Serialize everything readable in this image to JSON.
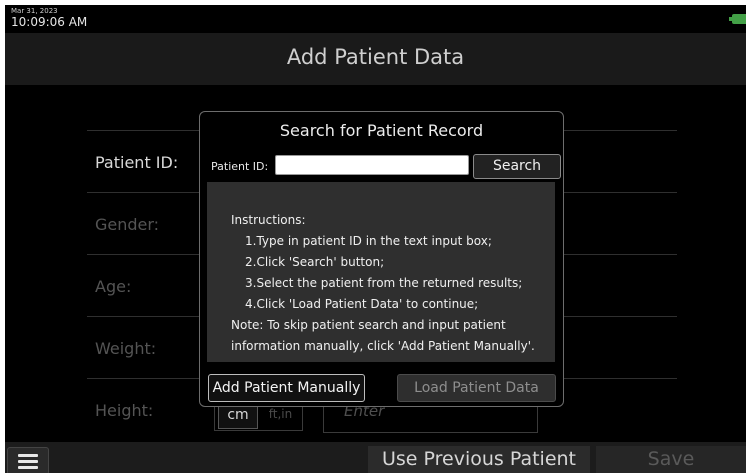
{
  "status": {
    "date": "Mar 31, 2023",
    "time": "10:09:06 AM",
    "battery_icon": "battery-icon"
  },
  "header": {
    "title": "Add Patient Data"
  },
  "form": {
    "fields": [
      {
        "label": "Patient ID:"
      },
      {
        "label": "Gender:"
      },
      {
        "label": "Age:"
      },
      {
        "label": "Weight:"
      },
      {
        "label": "Height:"
      }
    ],
    "height_units": {
      "cm": "cm",
      "ftin": "ft,in"
    },
    "height_placeholder": "Enter"
  },
  "modal": {
    "title": "Search for Patient Record",
    "patient_id_label": "Patient ID:",
    "patient_id_value": "",
    "search_label": "Search",
    "instructions": [
      "Instructions:",
      "1.Type in patient ID in the text input box;",
      "2.Click 'Search' button;",
      "3.Select the patient from the returned results;",
      "4.Click 'Load Patient Data' to continue;",
      "Note: To skip patient search and input patient",
      "information manually, click 'Add Patient Manually'."
    ],
    "add_manual_label": "Add Patient Manually",
    "load_label": "Load Patient Data"
  },
  "bottom": {
    "menu_icon": "hamburger-menu-icon",
    "prev_label": "Use Previous Patient",
    "save_label": "Save"
  }
}
